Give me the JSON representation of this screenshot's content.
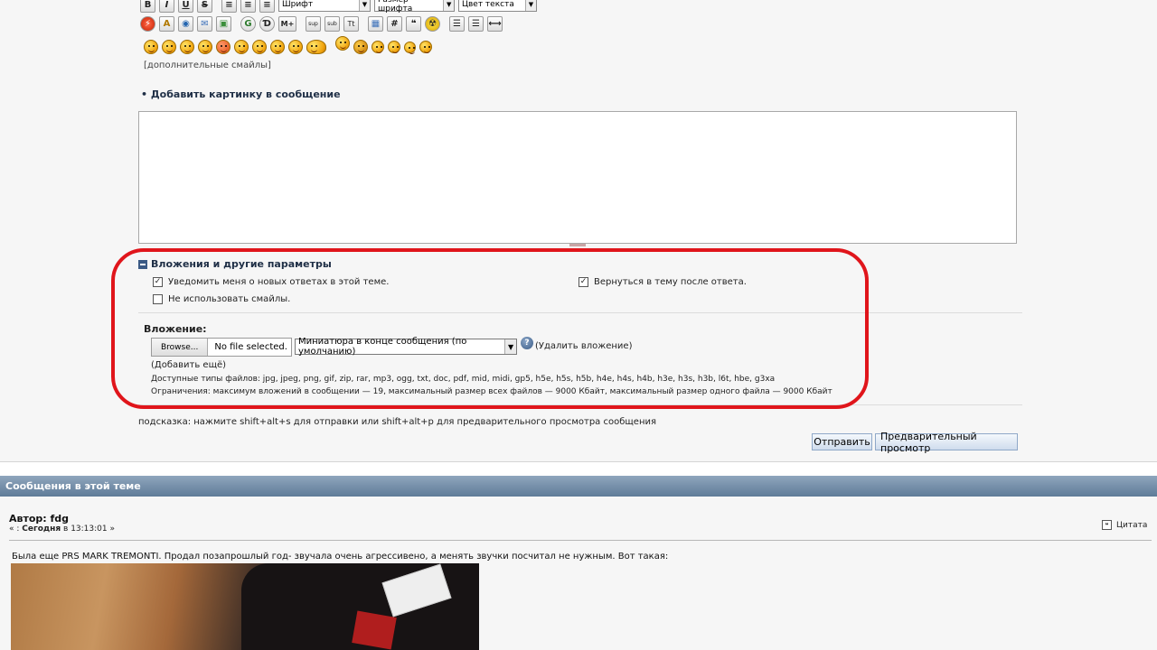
{
  "toolbar": {
    "bold": "B",
    "italic": "I",
    "underline": "U",
    "strike": "S",
    "font_select": "Шрифт",
    "size_select": "Размер шрифта",
    "color_select": "Цвет текста",
    "g_btn": "G",
    "d_btn": "Ɗ",
    "m_btn": "M+",
    "sup_btn": "sup",
    "sub_btn": "sub",
    "tt_btn": "Tt",
    "hash_btn": "#"
  },
  "smileys": {
    "more_link": "[дополнительные смайлы]"
  },
  "image_section": {
    "title": "• Добавить картинку в сообщение"
  },
  "options": {
    "title": "Вложения и другие параметры",
    "notify_label": "Уведомить меня о новых ответах в этой теме.",
    "notify_checked": true,
    "no_smileys_label": "Не использовать смайлы.",
    "no_smileys_checked": false,
    "return_label": "Вернуться в тему после ответа.",
    "return_checked": true
  },
  "attachment": {
    "label": "Вложение:",
    "browse": "Browse...",
    "file_status": "No file selected.",
    "thumbnail_option": "Миниатюра в конце сообщения (по умолчанию)",
    "help": "?",
    "remove": "(Удалить вложение)",
    "add_more": "(Добавить ещё)",
    "allowed_types": "Доступные типы файлов: jpg, jpeg, png, gif, zip, rar, mp3, ogg, txt, doc, pdf, mid, midi, gp5, h5e, h5s, h5b, h4e, h4s, h4b, h3e, h3s, h3b, l6t, hbe, g3xa",
    "limits": "Ограничения: максимум вложений в сообщении — 19, максимальный размер всех файлов — 9000 Кбайт, максимальный размер одного файла — 9000 Кбайт"
  },
  "hint": "подсказка: нажмите shift+alt+s для отправки или shift+alt+p для предварительного просмотра сообщения",
  "buttons": {
    "submit": "Отправить",
    "preview": "Предварительный просмотр"
  },
  "thread": {
    "title": "Сообщения в этой теме",
    "author": "Автор: fdg",
    "date_prefix": "« :",
    "date_day": "Сегодня",
    "date_rest": "в 13:13:01 »",
    "quote": "Цитата",
    "post_text": "Была еще PRS MARK TREMONTI. Продал позапрошлый год- звучала очень агрессивено, а менять звучки посчитал не нужным. Вот такая:"
  },
  "colors": {
    "highlight_oval": "#e0151b",
    "header_bar": "#6f88a3",
    "link_dark": "#1f2f46"
  }
}
